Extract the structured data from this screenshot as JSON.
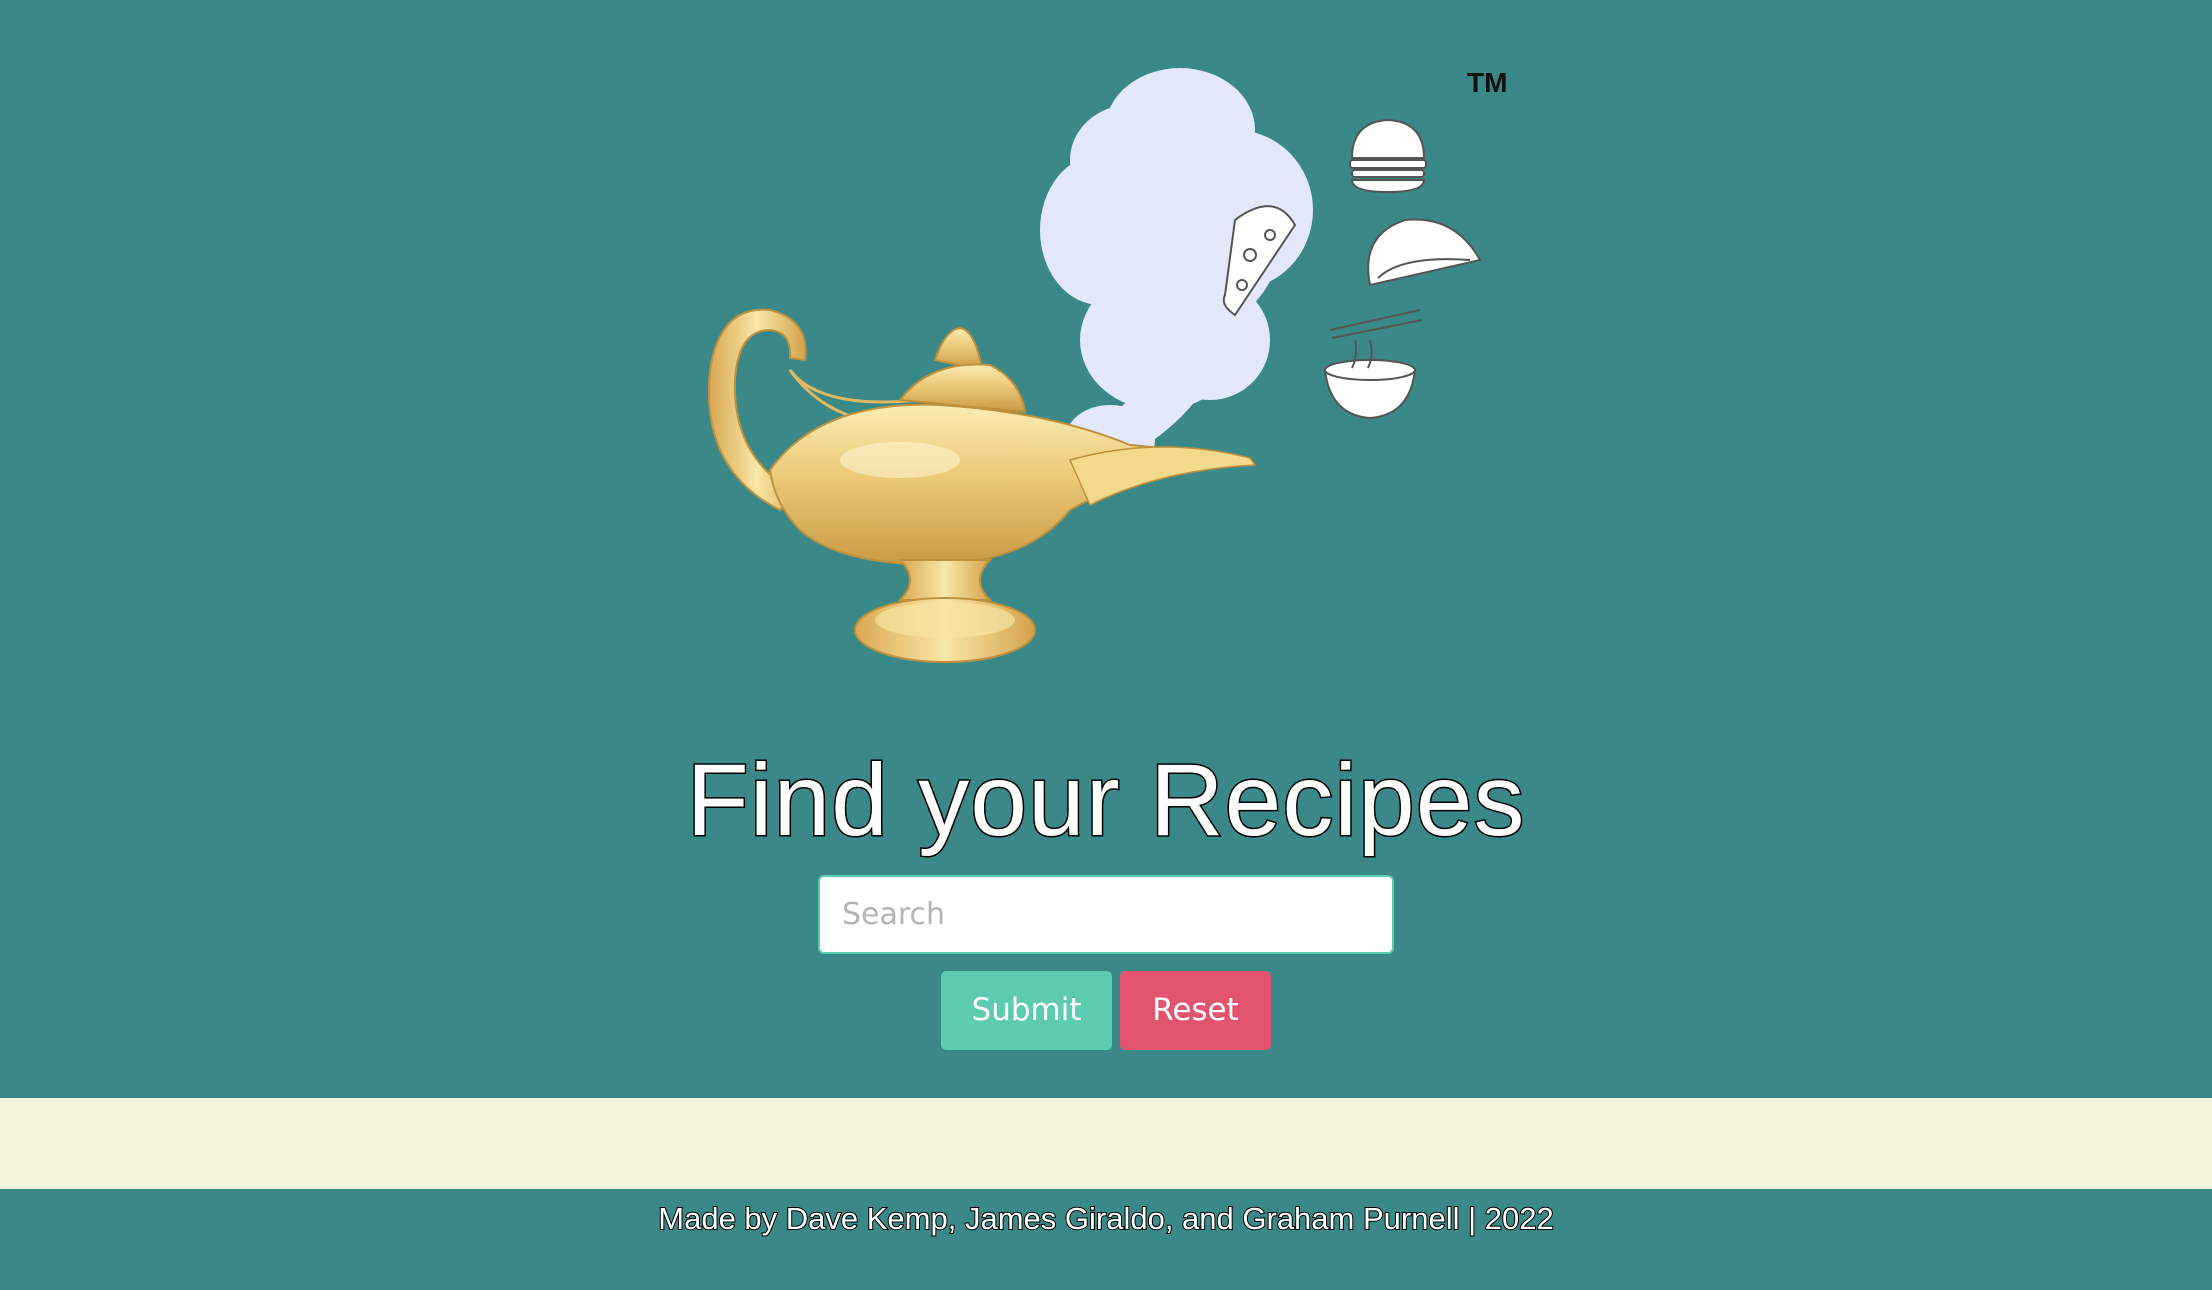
{
  "brand": {
    "trademark": "TM",
    "lamp_icon": "genie-lamp-icon",
    "food_icons": [
      "burger-icon",
      "pizza-slice-icon",
      "taco-icon",
      "noodle-bowl-icon"
    ]
  },
  "main": {
    "title": "Find your Recipes",
    "search": {
      "placeholder": "Search",
      "value": ""
    },
    "submit_label": "Submit",
    "reset_label": "Reset"
  },
  "footer": {
    "credits": "Made by Dave Kemp, James Giraldo, and Graham Purnell | 2022"
  },
  "colors": {
    "background": "#3b8889",
    "results_band": "#f4f4dd",
    "submit": "#5ccbb0",
    "reset": "#e2546e",
    "smoke": "#e3e9fb",
    "lamp_gold": "#e8c46a"
  }
}
